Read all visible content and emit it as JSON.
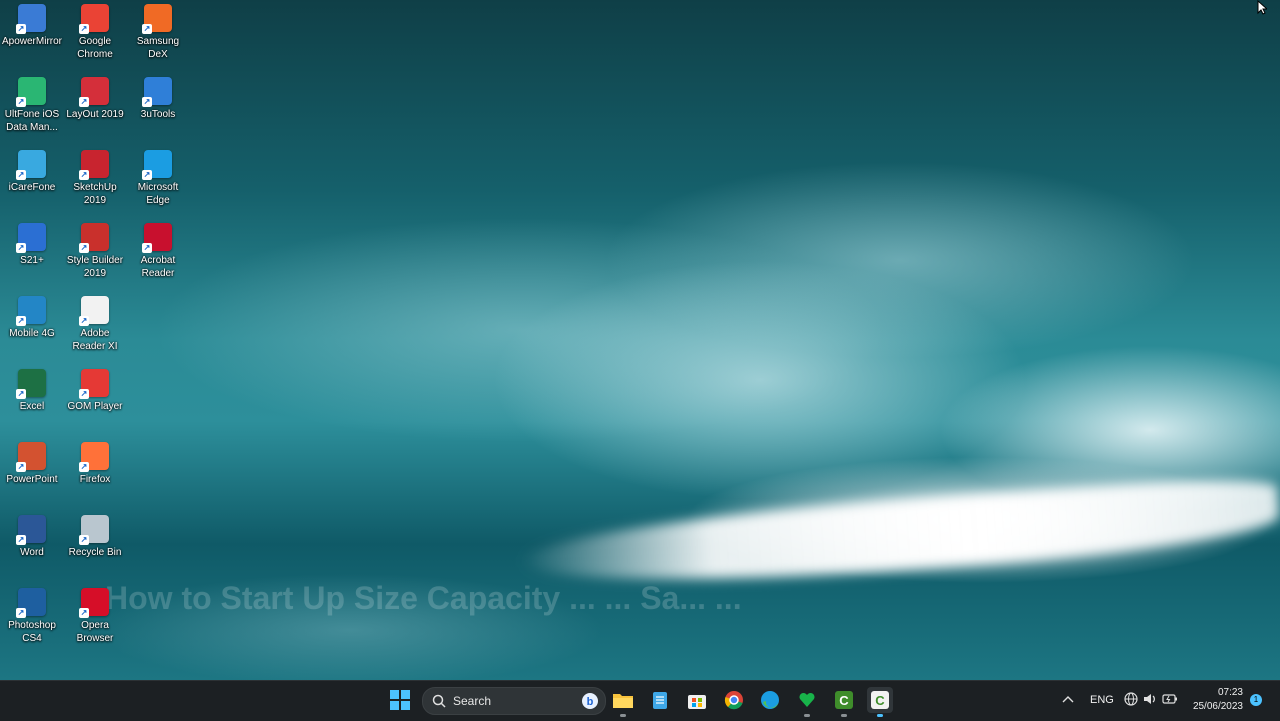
{
  "desktop": {
    "icons": [
      {
        "label": "ApowerMirror",
        "icon": "apowermirror-icon",
        "color": "#3a7bd5"
      },
      {
        "label": "Google Chrome",
        "icon": "chrome-icon",
        "color": "#ea4335"
      },
      {
        "label": "Samsung DeX",
        "icon": "samsung-dex-icon",
        "color": "#f06a25"
      },
      {
        "label": "UltFone iOS Data Man...",
        "icon": "ultfone-icon",
        "color": "#2ab673"
      },
      {
        "label": "LayOut 2019",
        "icon": "layout-icon",
        "color": "#d42f3a"
      },
      {
        "label": "3uTools",
        "icon": "3utools-icon",
        "color": "#2f7fd8"
      },
      {
        "label": "iCareFone",
        "icon": "icarefone-icon",
        "color": "#39a9e0"
      },
      {
        "label": "SketchUp 2019",
        "icon": "sketchup-icon",
        "color": "#c8242f"
      },
      {
        "label": "Microsoft Edge",
        "icon": "edge-icon",
        "color": "#1b9de2"
      },
      {
        "label": "S21+",
        "icon": "s21-icon",
        "color": "#2b6fd3"
      },
      {
        "label": "Style Builder 2019",
        "icon": "style-builder-icon",
        "color": "#c9302c"
      },
      {
        "label": "Acrobat Reader",
        "icon": "acrobat-icon",
        "color": "#c8102e"
      },
      {
        "label": "Mobile 4G",
        "icon": "mobile-4g-icon",
        "color": "#2386c6"
      },
      {
        "label": "Adobe Reader XI",
        "icon": "adobe-reader-icon",
        "color": "#f2f2f2"
      },
      {
        "label": "Excel",
        "icon": "excel-icon",
        "color": "#1d7044"
      },
      {
        "label": "GOM Player",
        "icon": "gom-player-icon",
        "color": "#e53935"
      },
      {
        "label": "PowerPoint",
        "icon": "powerpoint-icon",
        "color": "#d35230"
      },
      {
        "label": "Firefox",
        "icon": "firefox-icon",
        "color": "#ff7139"
      },
      {
        "label": "Word",
        "icon": "word-icon",
        "color": "#2b5797"
      },
      {
        "label": "Recycle Bin",
        "icon": "recycle-bin-icon",
        "color": "#b9c6cf"
      },
      {
        "label": "Photoshop CS4",
        "icon": "photoshop-icon",
        "color": "#1e5fa0"
      },
      {
        "label": "Opera Browser",
        "icon": "opera-icon",
        "color": "#d60e28"
      }
    ]
  },
  "watermark": "How to Start Up Size Capacity ... ... Sa... ...",
  "taskbar": {
    "search_placeholder": "Search",
    "language": "ENG",
    "time": "07:23",
    "date": "25/06/2023",
    "notification_count": "1"
  }
}
